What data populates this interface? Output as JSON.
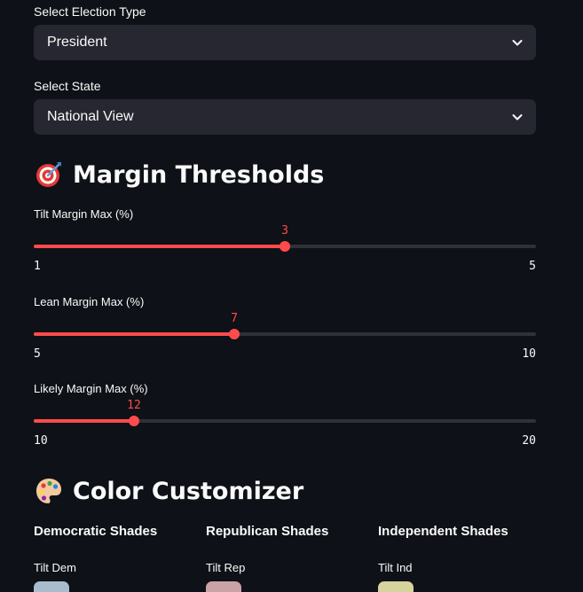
{
  "election_type": {
    "label": "Select Election Type",
    "value": "President"
  },
  "state": {
    "label": "Select State",
    "value": "National View"
  },
  "margin_thresholds": {
    "icon": "target-dart-icon",
    "title": "Margin Thresholds",
    "sliders": [
      {
        "label": "Tilt Margin Max (%)",
        "value": "3",
        "min": "1",
        "max": "5"
      },
      {
        "label": "Lean Margin Max (%)",
        "value": "7",
        "min": "5",
        "max": "10"
      },
      {
        "label": "Likely Margin Max (%)",
        "value": "12",
        "min": "10",
        "max": "20"
      }
    ]
  },
  "color_customizer": {
    "icon": "palette-icon",
    "title": "Color Customizer",
    "columns": [
      {
        "heading": "Democratic Shades",
        "first_label": "Tilt Dem",
        "swatch_color": "#a9bccd"
      },
      {
        "heading": "Republican Shades",
        "first_label": "Tilt Rep",
        "swatch_color": "#c9a3a6"
      },
      {
        "heading": "Independent Shades",
        "first_label": "Tilt Ind",
        "swatch_color": "#d7d39d"
      }
    ]
  },
  "colors": {
    "accent": "#ff4b4b",
    "background": "#0e1117",
    "widget": "#262730"
  }
}
